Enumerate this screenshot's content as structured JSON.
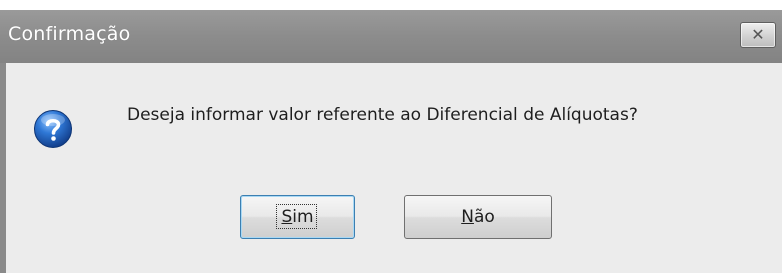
{
  "window": {
    "title": "Confirmação",
    "close_glyph": "✕"
  },
  "dialog": {
    "icon": "question-icon",
    "message": "Deseja informar valor referente ao Diferencial de Alíquotas?"
  },
  "buttons": {
    "yes": {
      "mnemonic": "S",
      "rest": "im"
    },
    "no": {
      "mnemonic": "N",
      "rest": "ão"
    }
  },
  "colors": {
    "titlebar": "#8c8c8c",
    "client_bg": "#ececec",
    "icon_blue": "#1f5fb5"
  }
}
